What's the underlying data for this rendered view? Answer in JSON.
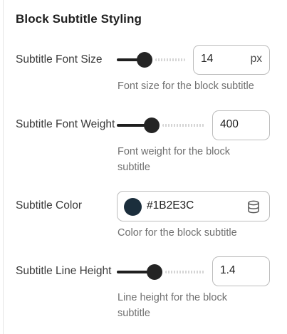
{
  "section": {
    "title": "Block Subtitle Styling"
  },
  "rows": [
    {
      "label": "Subtitle Font Size",
      "value": "14",
      "unit": "px",
      "help": "Font size for the block subtitle",
      "slider_fraction": 0.41
    },
    {
      "label": "Subtitle Font Weight",
      "value": "400",
      "help": "Font weight for the block subtitle",
      "slider_fraction": 0.4
    },
    {
      "label": "Subtitle Color",
      "value": "#1B2E3C",
      "color": "#1B2E3C",
      "icon": "database-icon",
      "help": "Color for the block subtitle"
    },
    {
      "label": "Subtitle Line Height",
      "value": "1.4",
      "help": "Line height for the block subtitle",
      "slider_fraction": 0.43
    }
  ],
  "colors": {
    "slider_fill": "#1f1f1f",
    "field_border": "#bdbdbd",
    "help_text": "#707070"
  }
}
